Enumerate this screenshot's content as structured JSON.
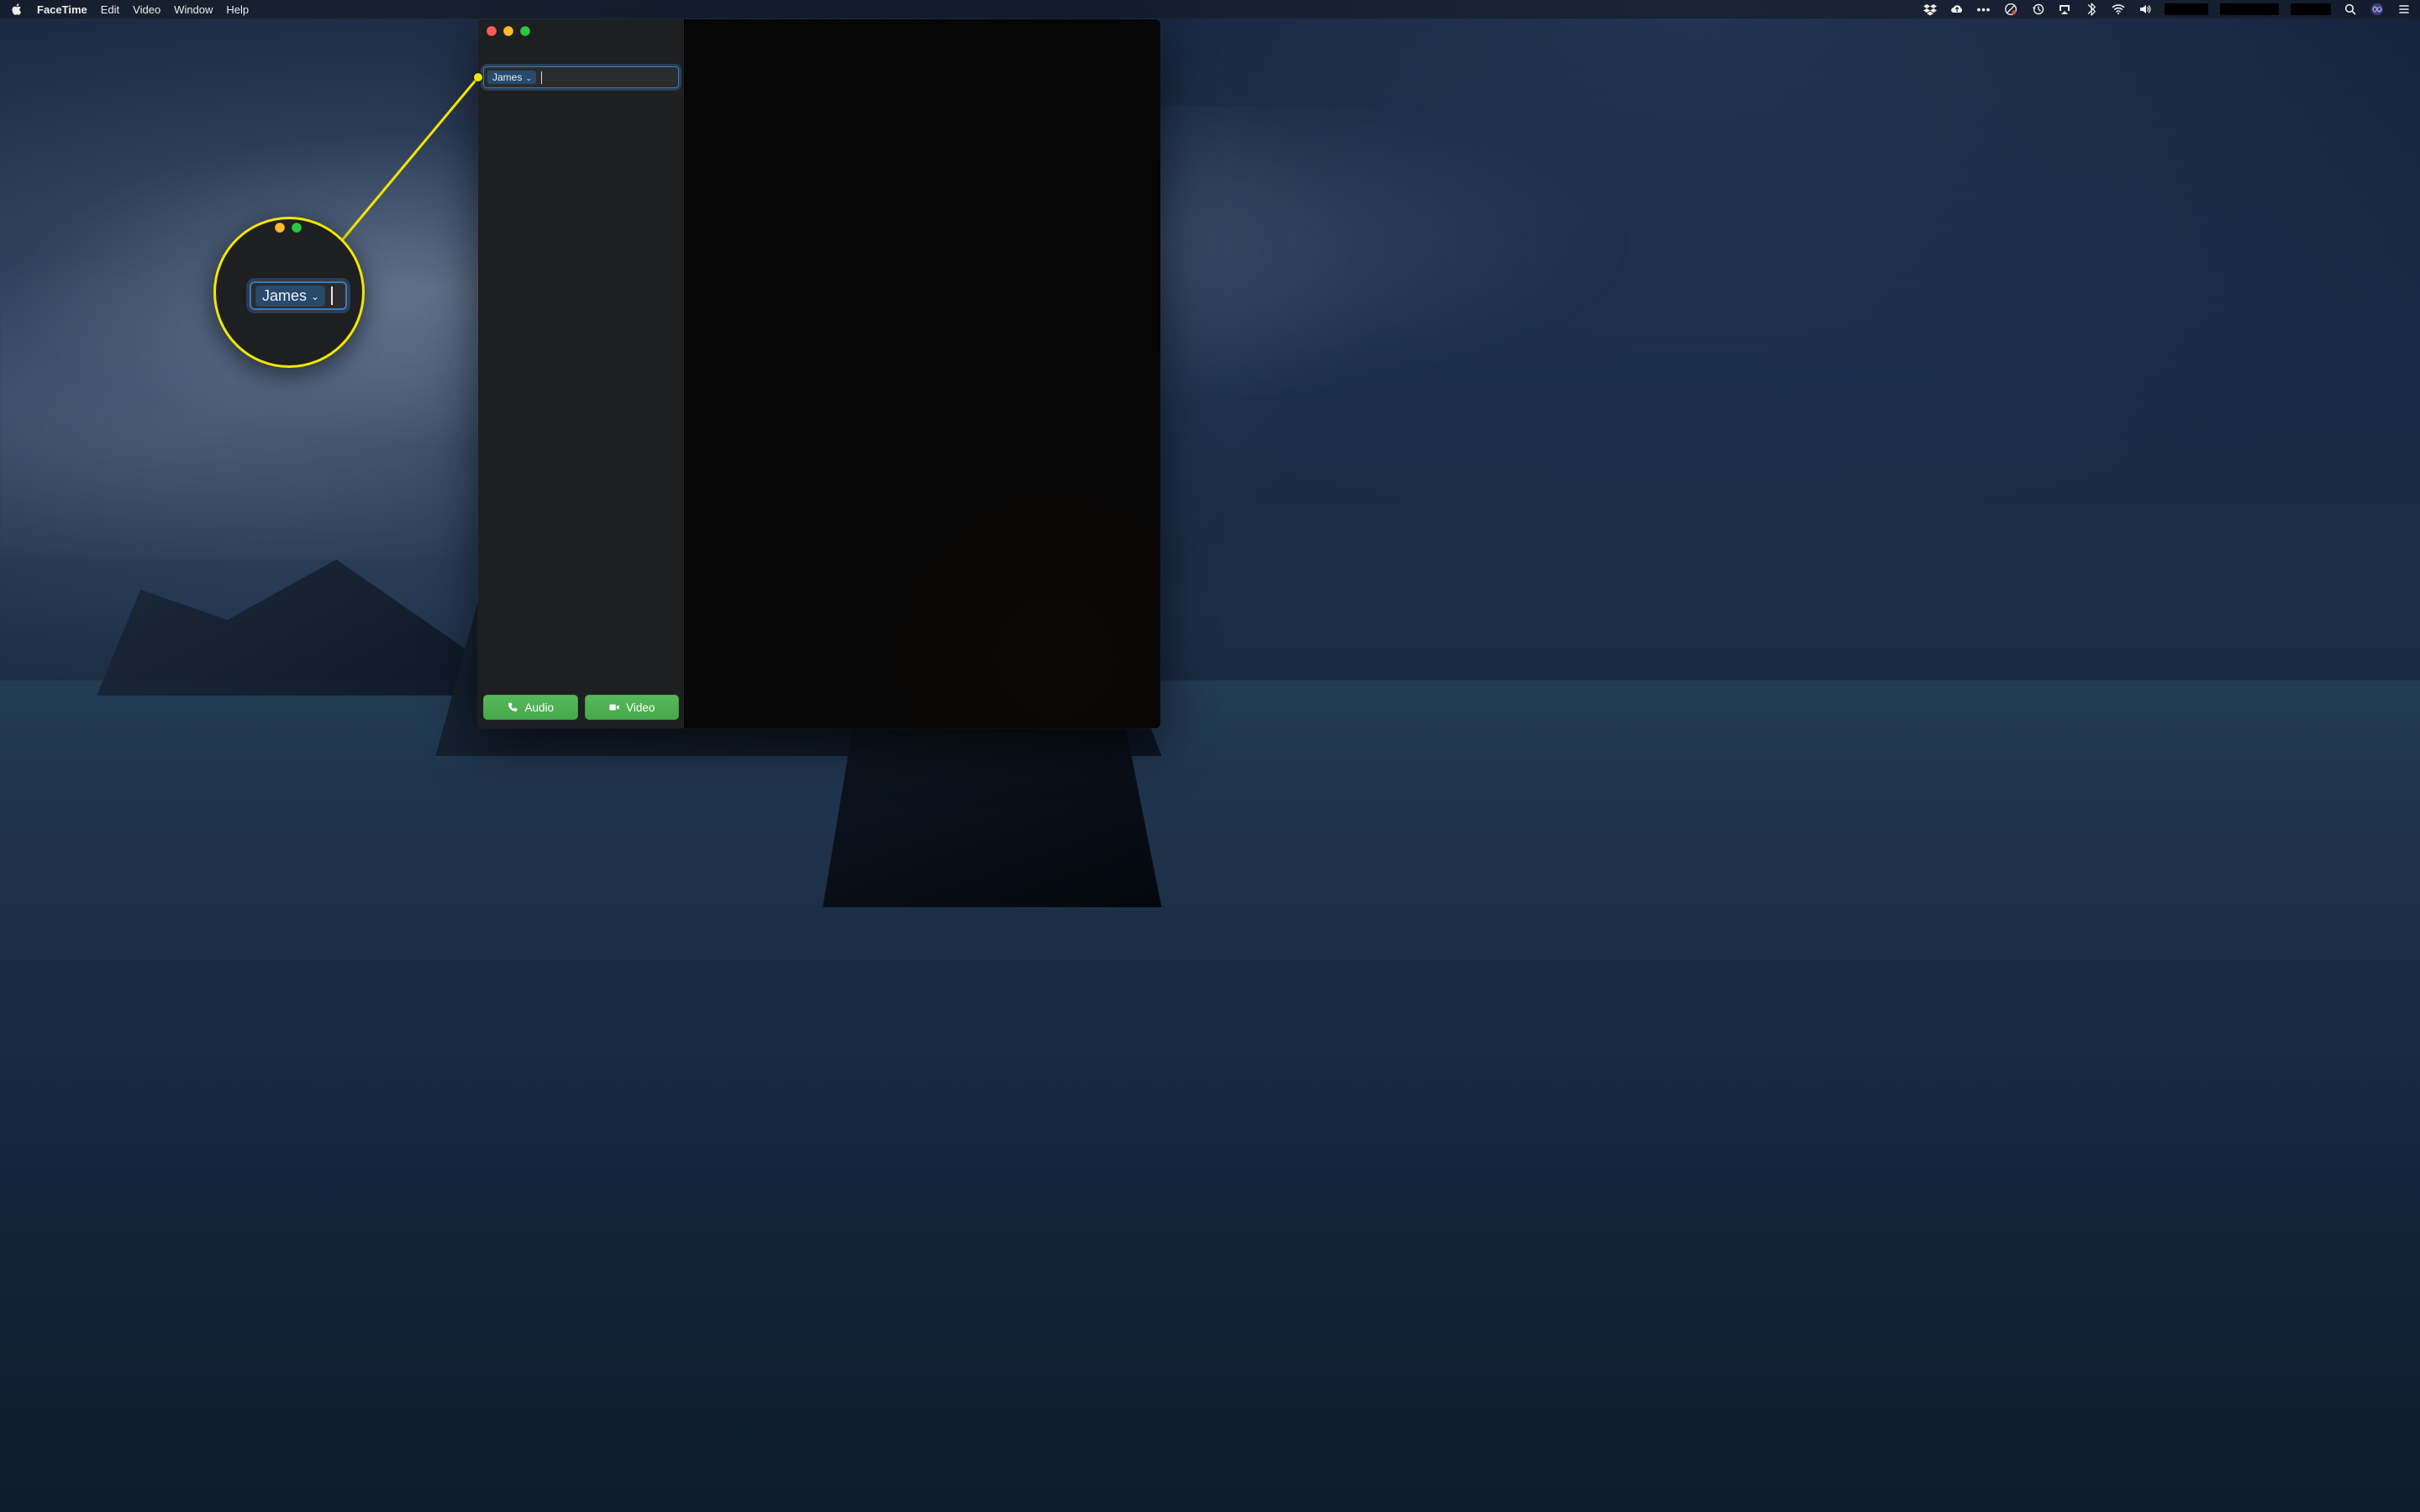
{
  "menubar": {
    "app_name": "FaceTime",
    "menus": {
      "edit": "Edit",
      "video": "Video",
      "window": "Window",
      "help": "Help"
    },
    "status_icons": [
      "dropbox-icon",
      "cloud-upload-icon",
      "more-icon",
      "do-not-disturb-icon",
      "time-machine-icon",
      "airplay-icon",
      "bluetooth-icon",
      "wifi-icon",
      "volume-icon"
    ],
    "right_icons": [
      "spotlight-icon",
      "siri-icon",
      "control-center-icon"
    ]
  },
  "facetime": {
    "recipient_token": "James",
    "buttons": {
      "audio": "Audio",
      "video": "Video"
    }
  },
  "callout": {
    "recipient_token": "James"
  },
  "colors": {
    "highlight": "#f2e600",
    "focus_ring": "#3e79b3",
    "call_green": "#4fb253"
  }
}
